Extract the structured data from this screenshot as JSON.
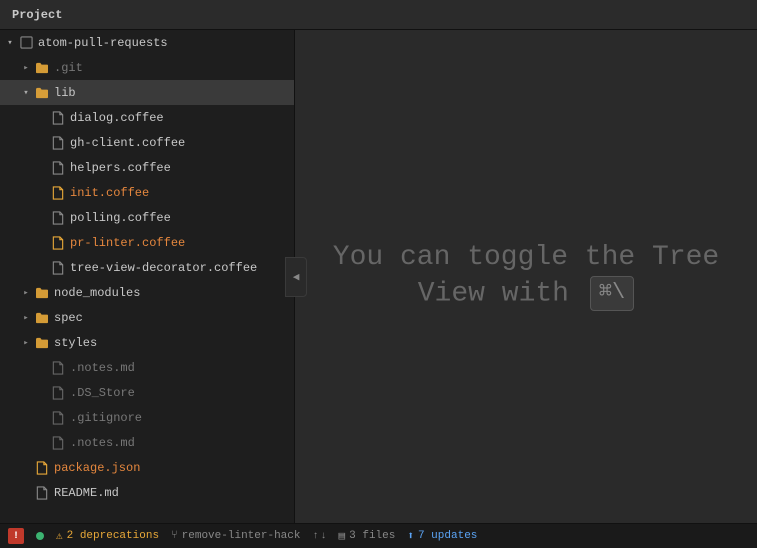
{
  "titlebar": {
    "label": "Project"
  },
  "sidebar": {
    "items": [
      {
        "id": "root",
        "indent": 0,
        "arrow": "open",
        "type": "root",
        "label": "atom-pull-requests",
        "style": "normal"
      },
      {
        "id": "git",
        "indent": 1,
        "arrow": "closed",
        "type": "folder",
        "label": ".git",
        "style": "dimmed"
      },
      {
        "id": "lib",
        "indent": 1,
        "arrow": "open",
        "type": "folder",
        "label": "lib",
        "style": "normal",
        "selected": true
      },
      {
        "id": "dialog",
        "indent": 2,
        "arrow": "none",
        "type": "file",
        "label": "dialog.coffee",
        "style": "normal"
      },
      {
        "id": "ghclient",
        "indent": 2,
        "arrow": "none",
        "type": "file",
        "label": "gh-client.coffee",
        "style": "normal"
      },
      {
        "id": "helpers",
        "indent": 2,
        "arrow": "none",
        "type": "file",
        "label": "helpers.coffee",
        "style": "normal"
      },
      {
        "id": "init",
        "indent": 2,
        "arrow": "none",
        "type": "file-modified",
        "label": "init.coffee",
        "style": "orange"
      },
      {
        "id": "polling",
        "indent": 2,
        "arrow": "none",
        "type": "file",
        "label": "polling.coffee",
        "style": "normal"
      },
      {
        "id": "pr-linter",
        "indent": 2,
        "arrow": "none",
        "type": "file-modified",
        "label": "pr-linter.coffee",
        "style": "orange"
      },
      {
        "id": "tree-view",
        "indent": 2,
        "arrow": "none",
        "type": "file",
        "label": "tree-view-decorator.coffee",
        "style": "normal"
      },
      {
        "id": "node_modules",
        "indent": 1,
        "arrow": "closed",
        "type": "folder",
        "label": "node_modules",
        "style": "normal"
      },
      {
        "id": "spec",
        "indent": 1,
        "arrow": "closed",
        "type": "folder",
        "label": "spec",
        "style": "normal"
      },
      {
        "id": "styles",
        "indent": 1,
        "arrow": "closed",
        "type": "folder",
        "label": "styles",
        "style": "normal"
      },
      {
        "id": "notes1",
        "indent": 2,
        "arrow": "none",
        "type": "file-dimmed",
        "label": ".notes.md",
        "style": "dimmed"
      },
      {
        "id": "ds_store",
        "indent": 2,
        "arrow": "none",
        "type": "file-dimmed",
        "label": ".DS_Store",
        "style": "dimmed"
      },
      {
        "id": "gitignore",
        "indent": 2,
        "arrow": "none",
        "type": "file-dimmed",
        "label": ".gitignore",
        "style": "dimmed"
      },
      {
        "id": "notes2",
        "indent": 2,
        "arrow": "none",
        "type": "file-dimmed",
        "label": ".notes.md",
        "style": "dimmed"
      },
      {
        "id": "package",
        "indent": 1,
        "arrow": "none",
        "type": "file-modified",
        "label": "package.json",
        "style": "orange"
      },
      {
        "id": "readme",
        "indent": 1,
        "arrow": "none",
        "type": "file",
        "label": "README.md",
        "style": "normal"
      }
    ]
  },
  "toggle_btn": {
    "label": "◀"
  },
  "hint": {
    "line1": "You can toggle the Tree",
    "line2": "View with",
    "shortcut": "⌘\\"
  },
  "statusbar": {
    "dot_color": "#3cb371",
    "warning_text": "2 deprecations",
    "branch": "remove-linter-hack",
    "files_text": "3 files",
    "updates_text": "7 updates",
    "error_label": "!"
  }
}
